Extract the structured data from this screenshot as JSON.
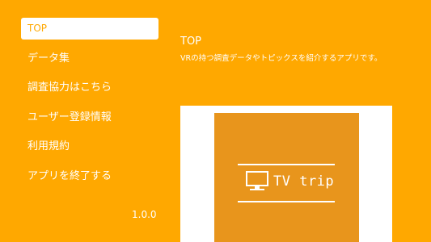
{
  "menu": {
    "items": [
      {
        "label": "TOP",
        "active": true
      },
      {
        "label": "データ集",
        "active": false
      },
      {
        "label": "調査協力はこちら",
        "active": false
      },
      {
        "label": "ユーザー登録情報",
        "active": false
      },
      {
        "label": "利用規約",
        "active": false
      },
      {
        "label": "アプリを終了する",
        "active": false
      }
    ],
    "version": "1.0.0"
  },
  "content": {
    "title": "TOP",
    "description": "VRの持つ調査データやトピックスを紹介するアプリです。",
    "app_tile_text": "TV trip",
    "app_tile_icon": "tv-icon"
  },
  "colors": {
    "background": "#FFA800",
    "tile": "#E8951C",
    "text": "#FFFFFF"
  }
}
